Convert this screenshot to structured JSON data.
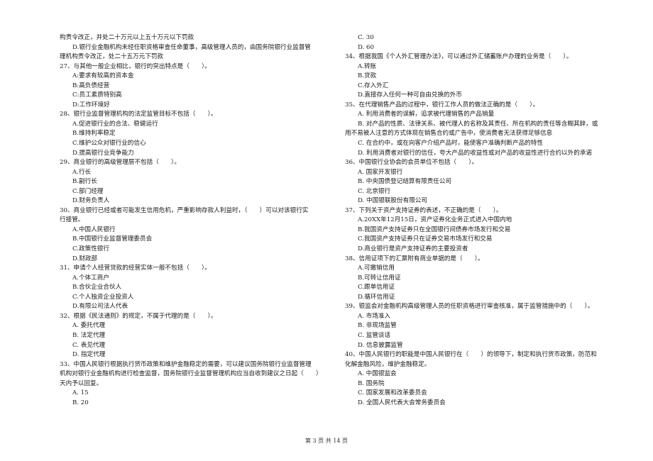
{
  "document": {
    "left_column": [
      {
        "text": "构责令改正，并处二十万元以上五十万元以下罚款",
        "indent": false
      },
      {
        "text": "D.银行业金融机构未经任职资格审查任命董事，高级管理人员的，由国务院银行业监督管",
        "indent": true
      },
      {
        "text": "理机构责令改正，处二十五万元下罚款",
        "indent": false
      },
      {
        "text": "27、与其他一般企业相比，银行的突出特点是（　　）。",
        "indent": false
      },
      {
        "text": "A:要求有较高的资本金",
        "indent": true
      },
      {
        "text": "B:高负债经营",
        "indent": true
      },
      {
        "text": "C:员工素质特别高",
        "indent": true
      },
      {
        "text": "D:工作环境好",
        "indent": true
      },
      {
        "text": "28、银行业监督管理机构的法定监管目标不包括（　　）。",
        "indent": false
      },
      {
        "text": "A.促进银行业的合法、稳健运行",
        "indent": true
      },
      {
        "text": "B.维持利率稳定",
        "indent": true
      },
      {
        "text": "C.维护公众对银行业的信心",
        "indent": true
      },
      {
        "text": "D.提高银行业竞争能力",
        "indent": true
      },
      {
        "text": "29、商业银行的高级管理层不包括（　　）。",
        "indent": false
      },
      {
        "text": "A.行长",
        "indent": true
      },
      {
        "text": "B.副行长",
        "indent": true
      },
      {
        "text": "C.部门经理",
        "indent": true
      },
      {
        "text": "D.财务负责人",
        "indent": true
      },
      {
        "text": "30、商业银行已经或者可能发生信用危机，严重影响存款人利益时，（　　）可以对该银行实",
        "indent": false
      },
      {
        "text": "行接管。",
        "indent": false
      },
      {
        "text": "A.中国人民银行",
        "indent": true
      },
      {
        "text": "B.中国银行业监督管理委员会",
        "indent": true
      },
      {
        "text": "C.政策性银行",
        "indent": true
      },
      {
        "text": "D.财政部",
        "indent": true
      },
      {
        "text": "31、申请个人经营贷款的经营实体一般不包括（　　）。",
        "indent": false
      },
      {
        "text": "A.个体工商户",
        "indent": true
      },
      {
        "text": "B.合伙企业合伙人",
        "indent": true
      },
      {
        "text": "C.个人独资企业投资人",
        "indent": true
      },
      {
        "text": "D.有限公司法人代表",
        "indent": true
      },
      {
        "text": "32、根据《民法通则》的规定，不属于代理的是（　　）。",
        "indent": false
      },
      {
        "text": "A. 委托代理",
        "indent": true
      },
      {
        "text": "B. 法定代理",
        "indent": true
      },
      {
        "text": "C. 表见代理",
        "indent": true
      },
      {
        "text": "D. 指定代理",
        "indent": true
      },
      {
        "text": "33、中国人民银行根据执行货币政策和维护金融稳定的需要，可以建议国务院银行业监督管理",
        "indent": false
      },
      {
        "text": "机构对银行业金融机构进行检查监督，国务院银行业监督管理机构应当自收到建议之日起（　　）",
        "indent": false
      },
      {
        "text": "天内予以回复。",
        "indent": false
      },
      {
        "text": "A. 15",
        "indent": true
      },
      {
        "text": "B. 20",
        "indent": true
      }
    ],
    "right_column": [
      {
        "text": "C. 30",
        "indent": true
      },
      {
        "text": "D. 60",
        "indent": true
      },
      {
        "text": "34、根据我国《个人外汇管理办法》，可以通过外汇储蓄账户办理的业务是（　　）。",
        "indent": false
      },
      {
        "text": "A.转账",
        "indent": true
      },
      {
        "text": "B.贷款",
        "indent": true
      },
      {
        "text": "C.存入外汇",
        "indent": true
      },
      {
        "text": "D.直接存入任何一种可自由兑换的外币",
        "indent": true
      },
      {
        "text": "35、在代理销售产品的过程中，银行工作人员的做法正确的是（　　）。",
        "indent": false
      },
      {
        "text": "A. 利用消费者的误解，追求被代理销售的产品销量",
        "indent": true
      },
      {
        "text": "B. 对产品的性质、法律关系、被代理人的名称及其责任、所在机构的责任等含糊其辞，或",
        "indent": true
      },
      {
        "text": "用不易被人注意的方式体现在销售合约或广告中，使消费者无法获得足够信息",
        "indent": false
      },
      {
        "text": "C. 在合约中，或在向客户介绍产品时，能使客户准确判断产品的特性",
        "indent": true
      },
      {
        "text": "D. 利用消费者对银行的信任，夸大产品的收益性或对产品的收益性进行合约以外的承诺",
        "indent": true
      },
      {
        "text": "36、中国银行业协会的会员单位不包括（　　）。",
        "indent": false
      },
      {
        "text": "A. 国家开发银行",
        "indent": true
      },
      {
        "text": "B. 中央国债登记结算有限责任公司",
        "indent": true
      },
      {
        "text": "C. 北京银行",
        "indent": true
      },
      {
        "text": "D. 中国银联股份有限公司",
        "indent": true
      },
      {
        "text": "37、下列关于资产支持证券的表述，不正确的是（　　）。",
        "indent": false
      },
      {
        "text": "A.20XX年12月15日，资产证券化业务正式进入中国内地",
        "indent": true
      },
      {
        "text": "B.我国资产支持证券只在全国银行间债券市场发行和交易",
        "indent": true
      },
      {
        "text": "C.我国资产支持证券只在证券交易市场发行和交易",
        "indent": true
      },
      {
        "text": "D.商业银行是资产支持证券的主要投资者",
        "indent": true
      },
      {
        "text": "38、信用证项下的汇票附有商业单据的是（　　）。",
        "indent": false
      },
      {
        "text": "A.可撤销信用",
        "indent": true
      },
      {
        "text": "B.可转让信用证",
        "indent": true
      },
      {
        "text": "C.跟单信用证",
        "indent": true
      },
      {
        "text": "D.循环信用证",
        "indent": true
      },
      {
        "text": "39、银监会对金融机构高级管理人员的任职资格进行审查核准，属于监管措施中的（　　）。",
        "indent": false
      },
      {
        "text": "A. 市场准入",
        "indent": true
      },
      {
        "text": "B. 非现场监管",
        "indent": true
      },
      {
        "text": "C. 监管谈话",
        "indent": true
      },
      {
        "text": "D. 信息披露监管",
        "indent": true
      },
      {
        "text": "40、中国人民银行的职能是中国人民银行在（　　）的领导下，制定和执行货币政策，防范和",
        "indent": false
      },
      {
        "text": "化解金融风险，维护金融稳定。",
        "indent": false
      },
      {
        "text": "A. 中国银监会",
        "indent": true
      },
      {
        "text": "B. 国务院",
        "indent": true
      },
      {
        "text": "C. 国家发展和改革委员会",
        "indent": true
      },
      {
        "text": "D. 全国人民代表大会常务委员会",
        "indent": true
      }
    ],
    "footer": {
      "page_label": "第 3 页 共 14 页"
    }
  }
}
